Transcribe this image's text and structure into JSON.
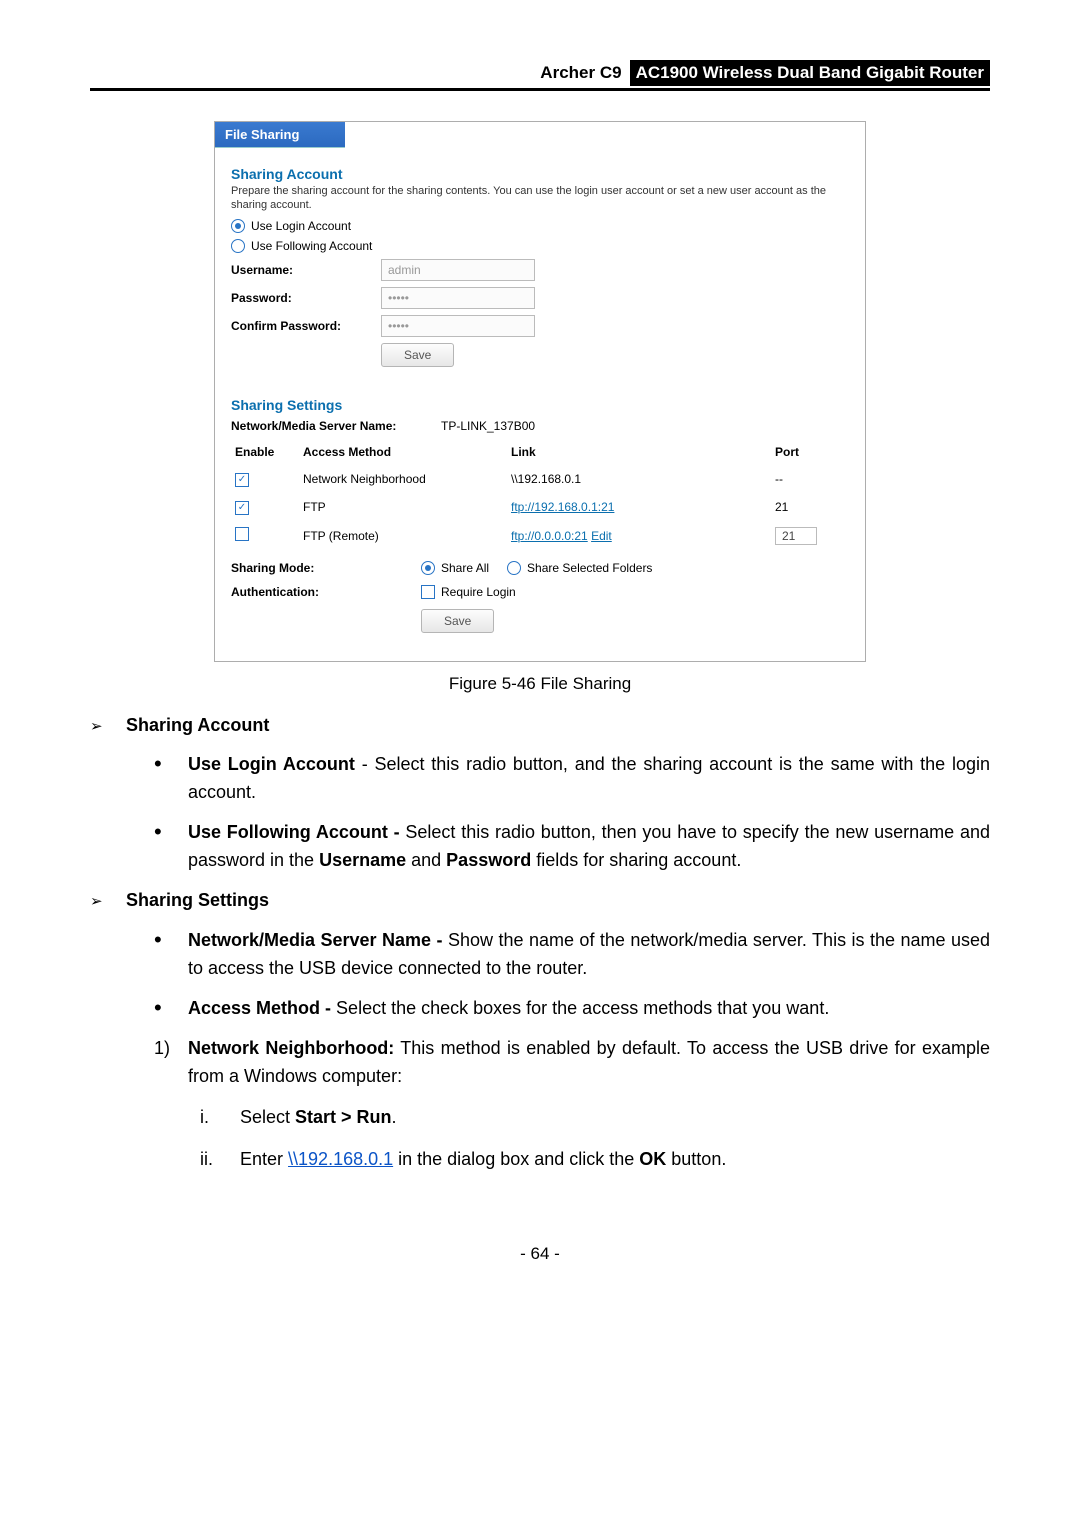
{
  "header": {
    "model": "Archer C9",
    "product": "AC1900 Wireless Dual Band Gigabit Router"
  },
  "panel": {
    "title": "File Sharing",
    "account": {
      "heading": "Sharing Account",
      "desc": "Prepare the sharing account for the sharing contents. You can use the login user account or set a new user account as the sharing account.",
      "opt_login": "Use Login Account",
      "opt_follow": "Use Following Account",
      "username_label": "Username:",
      "username_value": "admin",
      "password_label": "Password:",
      "password_value": "•••••",
      "confirm_label": "Confirm Password:",
      "confirm_value": "•••••",
      "save_label": "Save"
    },
    "settings": {
      "heading": "Sharing Settings",
      "server_name_label": "Network/Media Server Name:",
      "server_name_value": "TP-LINK_137B00",
      "cols": {
        "enable": "Enable",
        "method": "Access Method",
        "link": "Link",
        "port": "Port"
      },
      "rows": [
        {
          "enabled": true,
          "method": "Network Neighborhood",
          "link": "\\\\192.168.0.1",
          "isLink": false,
          "port": "--",
          "portBoxed": false,
          "edit": ""
        },
        {
          "enabled": true,
          "method": "FTP",
          "link": "ftp://192.168.0.1:21",
          "isLink": true,
          "port": "21",
          "portBoxed": false,
          "edit": ""
        },
        {
          "enabled": false,
          "method": "FTP (Remote)",
          "link": "ftp://0.0.0.0:21",
          "isLink": true,
          "port": "21",
          "portBoxed": true,
          "edit": "Edit"
        }
      ],
      "mode_label": "Sharing Mode:",
      "mode_all": "Share All",
      "mode_sel": "Share Selected Folders",
      "auth_label": "Authentication:",
      "auth_opt": "Require Login",
      "save_label": "Save"
    }
  },
  "caption": "Figure 5-46 File Sharing",
  "doc": {
    "s1": "Sharing Account",
    "s1a_b": "Use Login Account",
    "s1a_t": " - Select this radio button, and the sharing account is the same with the login account.",
    "s1b_b": "Use Following Account -",
    "s1b_t": " Select this radio button, then you have to specify the new username and password in the ",
    "s1b_u": "Username",
    "s1b_mid": " and ",
    "s1b_p": "Password",
    "s1b_end": " fields for sharing account.",
    "s2": "Sharing Settings",
    "s2a_b": "Network/Media Server Name -",
    "s2a_t": " Show the name of the network/media server. This is the name used to access the USB device connected to the router.",
    "s2b_b": "Access Method -",
    "s2b_t": " Select the check boxes for the access methods that you want.",
    "s2c_n": "1)",
    "s2c_b": "Network Neighborhood:",
    "s2c_t": " This method is enabled by default. To access the USB drive for example from a Windows computer:",
    "i_n": "i.",
    "i_t1": "Select ",
    "i_b": "Start > Run",
    "i_t2": ".",
    "ii_n": "ii.",
    "ii_t1": "Enter ",
    "ii_link": "\\\\192.168.0.1",
    "ii_t2": " in the dialog box and click the ",
    "ii_b": "OK",
    "ii_t3": " button."
  },
  "page_number": "- 64 -"
}
